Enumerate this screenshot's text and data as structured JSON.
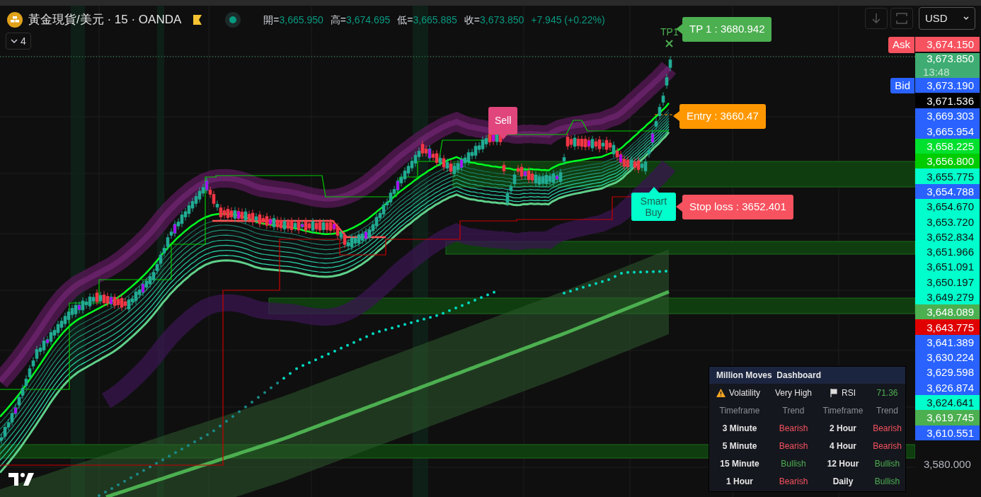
{
  "header": {
    "symbol": "黃金現貨/美元 · 15 · OANDA",
    "ohlc": [
      {
        "label": "開=",
        "value": "3,665.950"
      },
      {
        "label": "高=",
        "value": "3,674.695"
      },
      {
        "label": "低=",
        "value": "3,665.885"
      },
      {
        "label": "收=",
        "value": "3,673.850"
      }
    ],
    "change": "+7.945 (+0.22%)",
    "indicator_count": "4",
    "currency": "USD"
  },
  "chart_labels": {
    "tp_marker": "TP1",
    "tp": "TP 1 : 3680.942",
    "entry": "Entry : 3660.47",
    "stop_loss": "Stop loss : 3652.401",
    "sell": "Sell",
    "smart_buy": "Smart Buy"
  },
  "price_axis": {
    "labels": [
      {
        "value": "3,674.150",
        "color": "#f7525f",
        "side_label": {
          "text": "Ask",
          "color": "#f7525f"
        }
      },
      {
        "value": "3,673.850",
        "sub": "13:48",
        "color": "#3fad73"
      },
      {
        "value": "3,673.190",
        "color": "#2962ff",
        "side_label": {
          "text": "Bid",
          "color": "#2962ff"
        }
      },
      {
        "value": "3,671.536",
        "color": "#000000"
      },
      {
        "value": "3,669.303",
        "color": "#2962ff"
      },
      {
        "value": "3,665.954",
        "color": "#2962ff"
      },
      {
        "value": "3,658.225",
        "color": "#00e02e"
      },
      {
        "value": "3,656.800",
        "color": "#00cc00"
      },
      {
        "value": "3,655.775",
        "color": "#00ffcc"
      },
      {
        "value": "3,654.788",
        "color": "#2962ff"
      },
      {
        "value": "3,654.670",
        "color": "#00ffcc"
      },
      {
        "value": "3,653.720",
        "color": "#00ffcc"
      },
      {
        "value": "3,652.834",
        "color": "#00ffcc"
      },
      {
        "value": "3,651.966",
        "color": "#00ffcc"
      },
      {
        "value": "3,651.091",
        "color": "#00ffcc"
      },
      {
        "value": "3,650.197",
        "color": "#00ffcc"
      },
      {
        "value": "3,649.279",
        "color": "#00ffcc"
      },
      {
        "value": "3,648.089",
        "color": "#4caf50"
      },
      {
        "value": "3,643.775",
        "color": "#e00000"
      },
      {
        "value": "3,641.389",
        "color": "#2962ff"
      },
      {
        "value": "3,630.224",
        "color": "#2962ff"
      },
      {
        "value": "3,629.598",
        "color": "#2962ff"
      },
      {
        "value": "3,626.874",
        "color": "#2962ff"
      },
      {
        "value": "3,624.641",
        "color": "#00ffcc"
      },
      {
        "value": "3,619.745",
        "color": "#4caf50"
      },
      {
        "value": "3,610.551",
        "color": "#2962ff"
      }
    ],
    "bottom_tick": "3,580.000"
  },
  "dashboard": {
    "title": "Million Moves  Dashboard",
    "volatility": {
      "label": "Volatility",
      "value": "Very High"
    },
    "rsi": {
      "label": "RSI",
      "value": "71.36"
    },
    "headers": [
      "Timeframe",
      "Trend",
      "Timeframe",
      "Trend"
    ],
    "trends": [
      {
        "timeframe": "3 Minute",
        "trend": "Bearish",
        "bullish": false
      },
      {
        "timeframe": "2 Hour",
        "trend": "Bearish",
        "bullish": false
      },
      {
        "timeframe": "5 Minute",
        "trend": "Bearish",
        "bullish": false
      },
      {
        "timeframe": "4 Hour",
        "trend": "Bearish",
        "bullish": false
      },
      {
        "timeframe": "15 Minute",
        "trend": "Bullish",
        "bullish": true
      },
      {
        "timeframe": "12 Hour",
        "trend": "Bullish",
        "bullish": true
      },
      {
        "timeframe": "1 Hour",
        "trend": "Bearish",
        "bullish": false
      },
      {
        "timeframe": "Daily",
        "trend": "Bullish",
        "bullish": true
      }
    ]
  }
}
